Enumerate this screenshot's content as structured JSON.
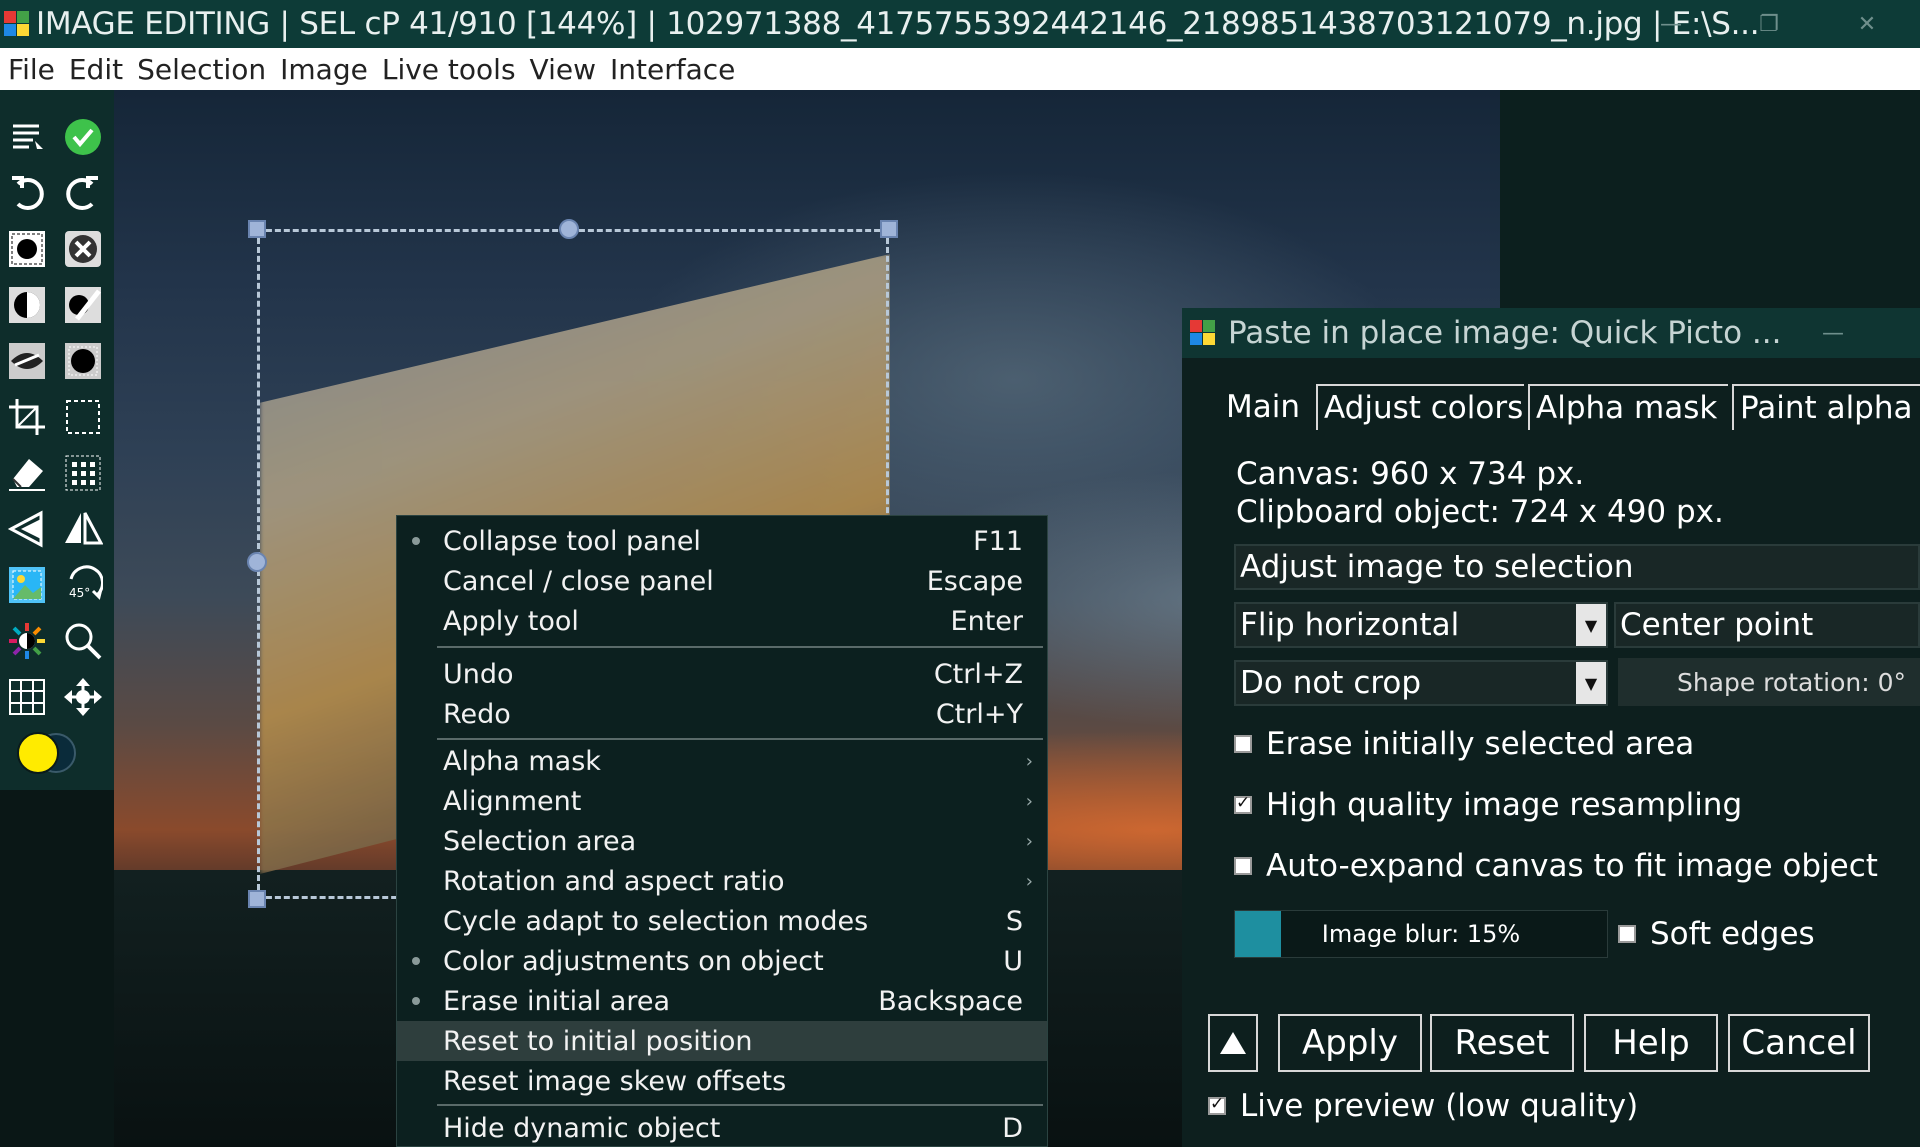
{
  "titlebar": {
    "title": "IMAGE EDITING | SEL cP 41/910 [144%] | 102971388_4175755392442146_2189851438703121079_n.jpg | E:\\S...",
    "minimize_icon": "minimize-icon",
    "restore_icon": "restore-icon",
    "close_icon": "close-icon"
  },
  "menubar": {
    "items": [
      "File",
      "Edit",
      "Selection",
      "Image",
      "Live tools",
      "View",
      "Interface"
    ]
  },
  "toolbar": {
    "tools": [
      "tool-menu-icon",
      "accept-check-icon",
      "undo-icon",
      "redo-icon",
      "mask-circle-icon",
      "cancel-x-icon",
      "contrast-icon",
      "brush-icon",
      "eye-icon",
      "grid-selection-icon",
      "crop-icon",
      "rect-select-icon",
      "eraser-icon",
      "magic-grid-icon",
      "flip-horizontal-icon",
      "mirror-icon",
      "picture-icon",
      "rotate-45-icon",
      "color-wheel-icon",
      "zoom-icon",
      "grid-icon",
      "move-icon",
      "color-swatch-icon"
    ],
    "rotate_label": "45°",
    "primary_color": "#ffeb00"
  },
  "context_menu": {
    "items": [
      {
        "label": "Collapse tool panel",
        "shortcut": "F11",
        "dot": true
      },
      {
        "label": "Cancel / close panel",
        "shortcut": "Escape"
      },
      {
        "label": "Apply tool",
        "shortcut": "Enter"
      },
      {
        "label": "Undo",
        "shortcut": "Ctrl+Z"
      },
      {
        "label": "Redo",
        "shortcut": "Ctrl+Y"
      },
      {
        "label": "Alpha mask",
        "submenu": true
      },
      {
        "label": "Alignment",
        "submenu": true
      },
      {
        "label": "Selection area",
        "submenu": true
      },
      {
        "label": "Rotation and aspect ratio",
        "submenu": true
      },
      {
        "label": "Cycle adapt to selection modes",
        "shortcut": "S"
      },
      {
        "label": "Color adjustments on object",
        "shortcut": "U",
        "dot": true
      },
      {
        "label": "Erase initial area",
        "shortcut": "Backspace",
        "dot": true
      },
      {
        "label": "Reset to initial position",
        "highlighted": true
      },
      {
        "label": "Reset image skew offsets"
      },
      {
        "label": "Hide dynamic object",
        "shortcut": "D"
      }
    ]
  },
  "dialog": {
    "title": "Paste in place image: Quick Picto ...",
    "minimize_icon": "minimize-icon",
    "tabs": [
      "Main",
      "Adjust colors",
      "Alpha mask",
      "Paint alpha m"
    ],
    "canvas_info": "Canvas: 960 x 734 px.",
    "clipboard_info": "Clipboard object: 724 x 490 px.",
    "adjust_mode": "Adjust image to selection",
    "flip_value": "Flip horizontal",
    "pivot_value": "Center point",
    "crop_value": "Do not crop",
    "shape_rotation": "Shape rotation: 0°",
    "checkboxes": [
      {
        "label": "Erase initially selected area",
        "checked": false
      },
      {
        "label": "High quality image resampling",
        "checked": true
      },
      {
        "label": "Auto-expand canvas to fit image object",
        "checked": false
      }
    ],
    "image_blur": "Image blur: 15%",
    "image_blur_value": 0.15,
    "soft_edges": {
      "label": "Soft edges",
      "checked": false
    },
    "buttons": {
      "up_icon": "triangle-up-icon",
      "apply": "Apply",
      "reset": "Reset",
      "help": "Help",
      "cancel": "Cancel"
    },
    "live_preview": {
      "label": "Live preview (low quality)",
      "checked": true
    },
    "accent": "#1e8fa0"
  }
}
